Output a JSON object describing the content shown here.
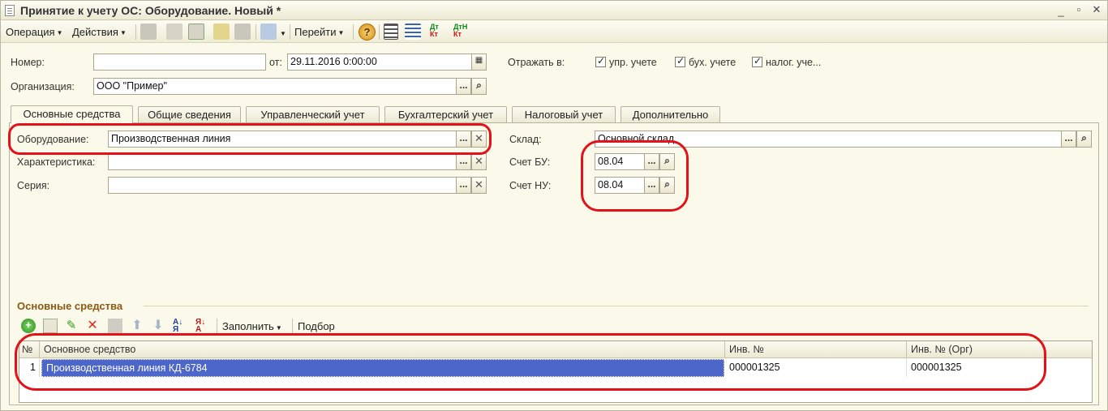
{
  "window": {
    "title": "Принятие к учету ОС: Оборудование. Новый *"
  },
  "toolbar": {
    "operation": "Операция",
    "actions": "Действия",
    "goto": "Перейти"
  },
  "header": {
    "number_label": "Номер:",
    "number_value": "",
    "date_label": "от:",
    "date_value": "29.11.2016  0:00:00",
    "reflect_label": "Отражать в:",
    "chk_mgmt": "упр. учете",
    "chk_acc": "бух. учете",
    "chk_tax": "налог. уче...",
    "org_label": "Организация:",
    "org_value": "ООО \"Пример\""
  },
  "tabs": [
    "Основные средства",
    "Общие сведения",
    "Управленческий учет",
    "Бухгалтерский учет",
    "Налоговый учет",
    "Дополнительно"
  ],
  "main": {
    "equipment_label": "Оборудование:",
    "equipment_value": "Производственная линия",
    "char_label": "Характеристика:",
    "char_value": "",
    "series_label": "Серия:",
    "series_value": "",
    "warehouse_label": "Склад:",
    "warehouse_value": "Основной склад",
    "bu_label": "Счет БУ:",
    "bu_value": "08.04",
    "nu_label": "Счет НУ:",
    "nu_value": "08.04"
  },
  "assets": {
    "title": "Основные средства",
    "fill": "Заполнить",
    "select": "Подбор",
    "columns": [
      "№",
      "Основное средство",
      "Инв. №",
      "Инв. № (Орг)"
    ],
    "rows": [
      {
        "n": "1",
        "asset": "Производственная линия КД-6784",
        "inv": "000001325",
        "inv_org": "000001325"
      }
    ]
  },
  "dtkt": {
    "dt": "Дт",
    "kt": "Кт",
    "dtn": "ДтН",
    "ktn": "Кт"
  },
  "icons": {
    "help": "?",
    "colors": {
      "accent": "#e3111a",
      "selection": "#4d66c9",
      "section_title": "#8b5a14"
    }
  }
}
